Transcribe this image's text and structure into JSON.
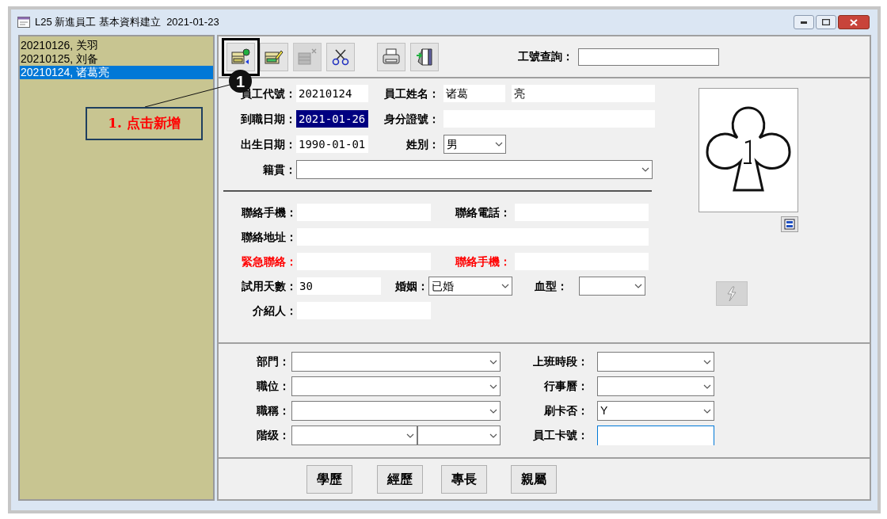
{
  "window": {
    "title": "L25 新進員工 基本資料建立  2021-01-23"
  },
  "employees": [
    {
      "text": "20210126, 关羽",
      "selected": false
    },
    {
      "text": "20210125, 刘备",
      "selected": false
    },
    {
      "text": "20210124, 诸葛亮",
      "selected": true
    }
  ],
  "toolbar": [
    {
      "kind": "add",
      "disabled": false,
      "annotated": true
    },
    {
      "kind": "edit",
      "disabled": false,
      "annotated": false
    },
    {
      "kind": "delete",
      "disabled": true,
      "annotated": false
    },
    {
      "kind": "cut",
      "disabled": false,
      "annotated": false
    },
    {
      "kind": "print",
      "disabled": false,
      "annotated": false
    },
    {
      "kind": "exit",
      "disabled": false,
      "annotated": false
    }
  ],
  "id_lookup": {
    "label": "工號查詢："
  },
  "callout": {
    "badge": "1",
    "text": "1. 点击新增"
  },
  "basic": {
    "employee_id": {
      "label": "員工代號：",
      "value": "20210124"
    },
    "name": {
      "label": "員工姓名：",
      "surname": "诸葛",
      "given_name": "亮"
    },
    "hire_date": {
      "label": "到職日期：",
      "value": "2021-01-26",
      "selected": true
    },
    "id_number": {
      "label": "身分證號："
    },
    "birth_date": {
      "label": "出生日期：",
      "value": "1990-01-01"
    },
    "gender": {
      "label": "姓別：",
      "value": "男"
    },
    "native_place": {
      "label": "籍貫："
    }
  },
  "contact": {
    "mobile": {
      "label": "聯絡手機：",
      "alert": false
    },
    "phone": {
      "label": "聯絡電話：",
      "alert": false
    },
    "address": {
      "label": "聯絡地址：",
      "alert": false
    },
    "emergency_contact": {
      "label": "緊急聯絡：",
      "alert": true
    },
    "emergency_mobile": {
      "label": "聯絡手機：",
      "alert": true
    }
  },
  "other": {
    "probation_days": {
      "label": "試用天數：",
      "value": "30"
    },
    "marital": {
      "label": "婚姻：",
      "value": "已婚"
    },
    "blood_type": {
      "label": "血型："
    },
    "referrer": {
      "label": "介紹人："
    }
  },
  "flash_button": {
    "disabled": true
  },
  "job": {
    "department": {
      "label": "部門："
    },
    "shift": {
      "label": "上班時段："
    },
    "position": {
      "label": "職位："
    },
    "calendar": {
      "label": "行事曆："
    },
    "title": {
      "label": "職稱："
    },
    "card_swipe": {
      "label": "刷卡否：",
      "value": "Y"
    },
    "grade": {
      "label": "階级："
    },
    "card_number": {
      "label": "員工卡號：",
      "focused": true
    }
  },
  "buttons": [
    "學歷",
    "經歷",
    "專長",
    "親屬"
  ]
}
